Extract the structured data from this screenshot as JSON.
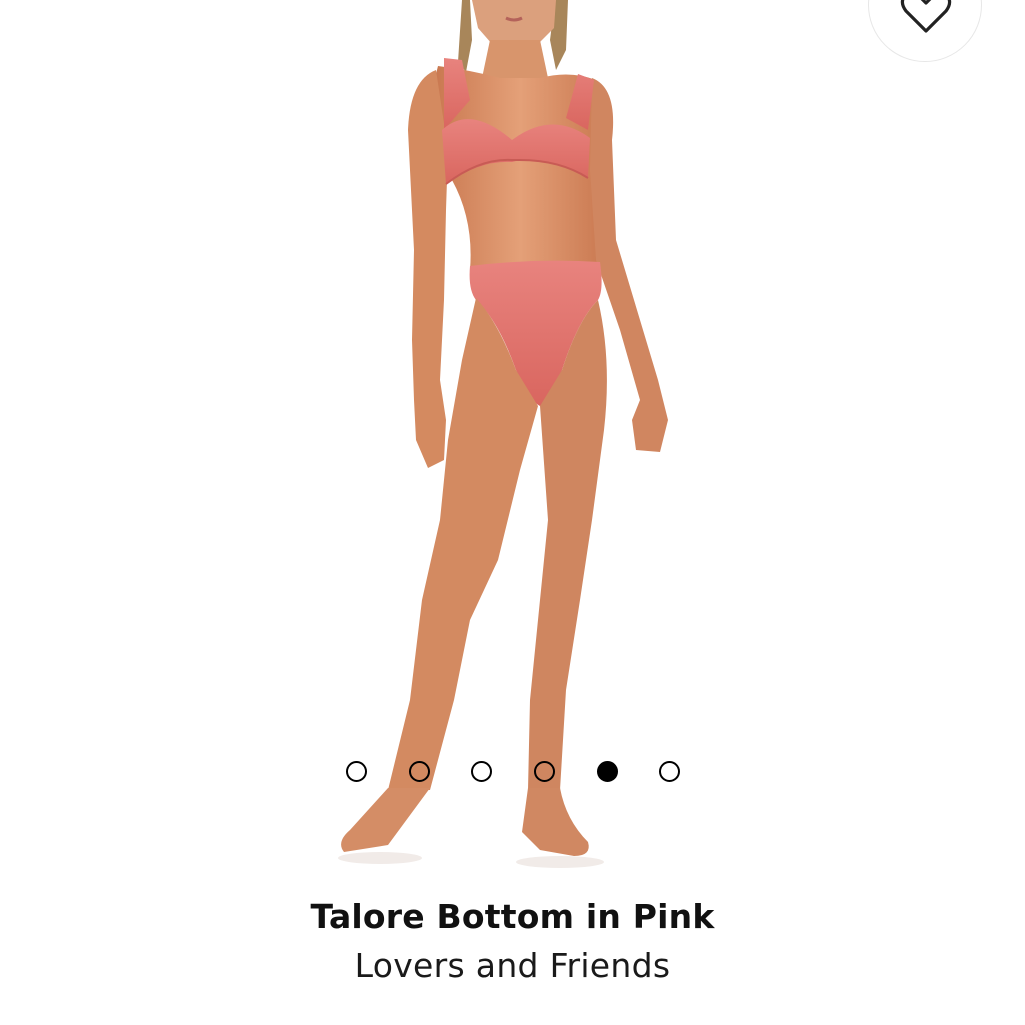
{
  "product": {
    "title": "Talore Bottom in Pink",
    "brand": "Lovers and Friends"
  },
  "carousel": {
    "total": 6,
    "active_index": 4
  },
  "icons": {
    "wishlist": "heart-icon"
  },
  "colors": {
    "swimwear": "#e0706e",
    "skin": "#d98d62",
    "dot": "#000000"
  }
}
